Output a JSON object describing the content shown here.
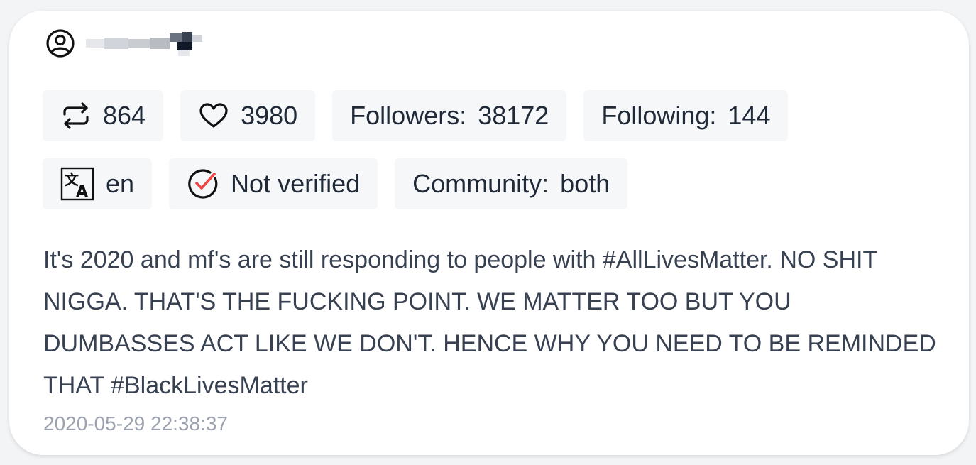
{
  "user": {
    "icon": "user-circle-icon",
    "username_obscured": true
  },
  "stats": {
    "retweets": "864",
    "likes": "3980",
    "followers_label": "Followers:",
    "followers_value": "38172",
    "following_label": "Following:",
    "following_value": "144"
  },
  "meta": {
    "language": "en",
    "verified_text": "Not verified",
    "community_label": "Community:",
    "community_value": "both"
  },
  "tweet": {
    "text": "It's 2020 and mf's are still responding to people with #AllLivesMatter. NO SHIT NIGGA. THAT'S THE FUCKING POINT. WE MATTER TOO BUT YOU DUMBASSES ACT LIKE WE DON'T. HENCE WHY YOU NEED TO BE REMINDED THAT #BlackLivesMatter",
    "timestamp": "2020-05-29 22:38:37"
  },
  "colors": {
    "card_bg": "#ffffff",
    "chip_bg": "#f6f7f9",
    "check_accent": "#ef4444",
    "timestamp": "#9ca3af"
  }
}
